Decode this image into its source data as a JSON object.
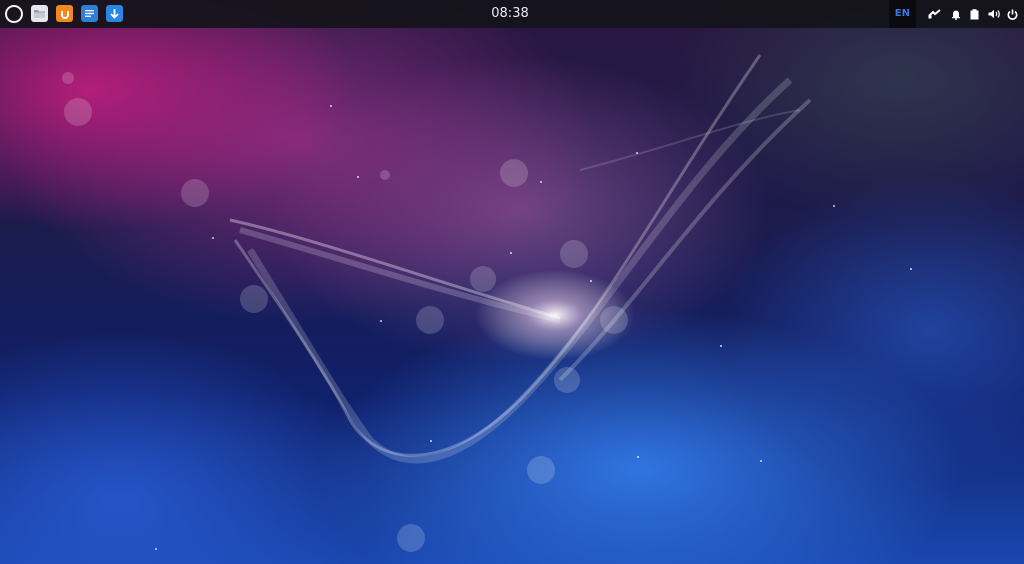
{
  "topbar": {
    "launcher_icon": "launcher-circle-icon",
    "dock": [
      {
        "name": "files",
        "icon": "folder-icon",
        "color": "#e8e8ee"
      },
      {
        "name": "store",
        "icon": "software-store-icon",
        "color": "#f08a1e"
      },
      {
        "name": "editor",
        "icon": "text-editor-icon",
        "color": "#2f7fd8"
      },
      {
        "name": "download",
        "icon": "download-icon",
        "color": "#2a86e0"
      }
    ],
    "clock": "08:38",
    "tray": {
      "language": "EN",
      "icons": [
        "network-icon",
        "notification-bell-icon",
        "clipboard-icon",
        "volume-icon",
        "power-icon"
      ]
    }
  },
  "colors": {
    "panel_bg": "#141418",
    "accent": "#3b78d8",
    "wallpaper_pink": "#c81e82",
    "wallpaper_blue": "#3278e6"
  }
}
